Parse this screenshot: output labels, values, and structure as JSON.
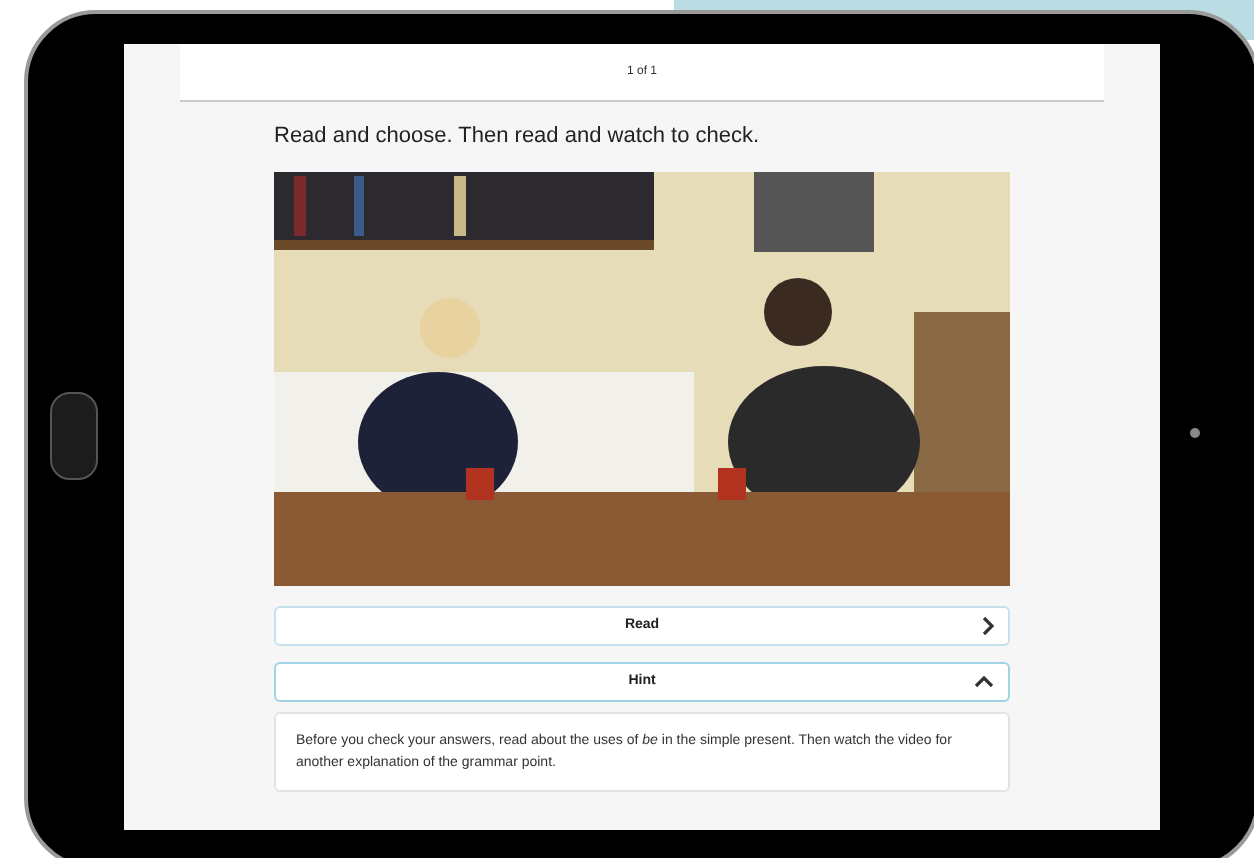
{
  "header": {
    "page_indicator": "1 of 1"
  },
  "instruction": "Read and choose. Then read and watch to check.",
  "sections": [
    {
      "label": "Read",
      "expanded": false
    },
    {
      "label": "Hint",
      "expanded": true,
      "body": "Before you check your answers, read about the uses of *be* in the simple present. Then watch the video for another explanation of the grammar point."
    }
  ]
}
